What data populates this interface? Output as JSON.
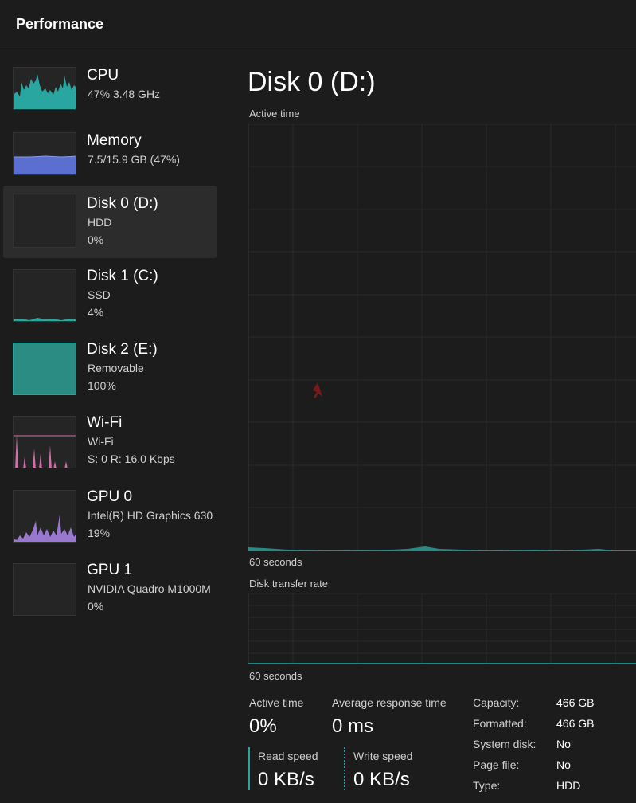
{
  "header": {
    "title": "Performance"
  },
  "sidebar": {
    "items": [
      {
        "name": "CPU",
        "line1": "47%  3.48 GHz",
        "line2": "",
        "color": "#2aa6a0"
      },
      {
        "name": "Memory",
        "line1": "7.5/15.9 GB (47%)",
        "line2": "",
        "color": "#5a6fd0"
      },
      {
        "name": "Disk 0 (D:)",
        "line1": "HDD",
        "line2": "0%",
        "color": "#2aa6a0"
      },
      {
        "name": "Disk 1 (C:)",
        "line1": "SSD",
        "line2": "4%",
        "color": "#2aa6a0"
      },
      {
        "name": "Disk 2 (E:)",
        "line1": "Removable",
        "line2": "100%",
        "color": "#2a8c82"
      },
      {
        "name": "Wi-Fi",
        "line1": "Wi-Fi",
        "line2": "S: 0  R: 16.0 Kbps",
        "color": "#d070a8"
      },
      {
        "name": "GPU 0",
        "line1": "Intel(R) HD Graphics 630",
        "line2": "19%",
        "color": "#9a78d0"
      },
      {
        "name": "GPU 1",
        "line1": "NVIDIA Quadro M1000M",
        "line2": "0%",
        "color": "#2aa6a0"
      }
    ],
    "selected_index": 2
  },
  "main": {
    "title": "Disk 0 (D:)",
    "active_time_label": "Active time",
    "time_window_1": "60 seconds",
    "transfer_rate_label": "Disk transfer rate",
    "time_window_2": "60 seconds",
    "stats": {
      "active_time": {
        "label": "Active time",
        "value": "0%"
      },
      "avg_response": {
        "label": "Average response time",
        "value": "0 ms"
      },
      "read_speed": {
        "label": "Read speed",
        "value": "0 KB/s"
      },
      "write_speed": {
        "label": "Write speed",
        "value": "0 KB/s"
      }
    },
    "properties": [
      {
        "key": "Capacity:",
        "value": "466 GB"
      },
      {
        "key": "Formatted:",
        "value": "466 GB"
      },
      {
        "key": "System disk:",
        "value": "No"
      },
      {
        "key": "Page file:",
        "value": "No"
      },
      {
        "key": "Type:",
        "value": "HDD"
      }
    ]
  },
  "colors": {
    "accent_disk": "#2aa6a0",
    "background": "#1c1c1c",
    "selected_bg": "#2c2c2c",
    "grid": "#2a2a2a"
  }
}
